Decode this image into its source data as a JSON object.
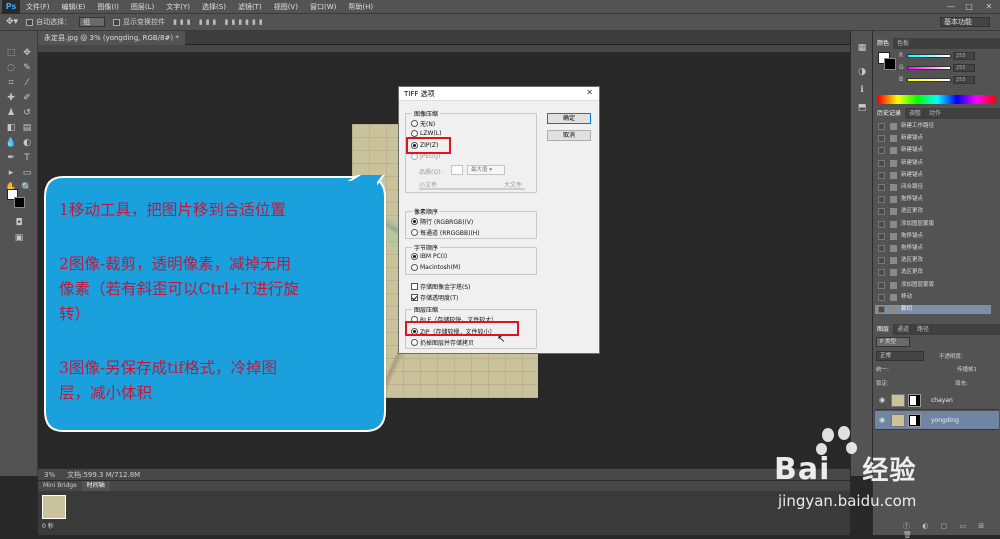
{
  "app": {
    "logo": "Ps"
  },
  "menu": [
    "文件(F)",
    "编辑(E)",
    "图像(I)",
    "图层(L)",
    "文字(Y)",
    "选择(S)",
    "滤镜(T)",
    "视图(V)",
    "窗口(W)",
    "帮助(H)"
  ],
  "options_bar": {
    "auto_select_label": "自动选择：",
    "auto_select_value": "组",
    "show_transform_label": "显示变换控件",
    "workspace": "基本功能"
  },
  "document": {
    "tab_title": "永定县.jpg @ 3% (yongding, RGB/8#) *",
    "zoom": "3%",
    "doc_size": "文档:599.3 M/712.8M"
  },
  "bridge": {
    "tabs": [
      "Mini Bridge",
      "时间轴"
    ],
    "frame_time": "0 秒"
  },
  "color_panel": {
    "tabs": [
      "颜色",
      "色板"
    ],
    "channels": [
      {
        "label": "R",
        "value": "255"
      },
      {
        "label": "G",
        "value": "255"
      },
      {
        "label": "B",
        "value": "255"
      }
    ]
  },
  "history_panel": {
    "tabs": [
      "历史记录",
      "调整",
      "动作"
    ],
    "items": [
      "新建工作路径",
      "新建锚点",
      "新建锚点",
      "新建锚点",
      "新建锚点",
      "闭合路径",
      "拖移锚点",
      "选区更改",
      "添加图层蒙版",
      "拖移锚点",
      "拖移锚点",
      "选区更改",
      "选区更改",
      "添加图层蒙版",
      "移动",
      "裁切"
    ],
    "selected_index": 15
  },
  "layers_panel": {
    "tabs": [
      "图层",
      "通道",
      "路径"
    ],
    "filter_label": "P 类型",
    "blend_mode": "正常",
    "opacity_label": "不透明度:",
    "lock_label": "锁定:",
    "fill_label": "填充:",
    "propagate_label": "传播帧1",
    "unify_label": "统一:",
    "layers": [
      {
        "name": "chayan",
        "selected": false
      },
      {
        "name": "yongding",
        "selected": true
      }
    ]
  },
  "dialog": {
    "title": "TIFF 选项",
    "image_compression": {
      "label": "图像压缩",
      "options": [
        "无(N)",
        "LZW(L)",
        "ZIP(Z)",
        "JPEG(J)"
      ],
      "selected": "ZIP(Z)",
      "quality_label": "品质(Q):",
      "quality_value": "最大值",
      "small_file": "小文件",
      "large_file": "大文件"
    },
    "pixel_order": {
      "label": "像素顺序",
      "options": [
        "隔行 (RGBRGB)(V)",
        "每通道 (RRGGBB)(H)"
      ],
      "selected": "隔行 (RGBRGB)(V)"
    },
    "byte_order": {
      "label": "字节顺序",
      "options": [
        "IBM PC(I)",
        "Macintosh(M)"
      ],
      "selected": "IBM PC(I)"
    },
    "save_pyramid": "存储图像金字塔(S)",
    "save_transparency": "存储透明度(T)",
    "layer_compression": {
      "label": "图层压缩",
      "options": [
        "RLE（存储较快，文件较大）",
        "ZIP（存储较慢，文件较小）",
        "扔掉图层并存储拷贝"
      ],
      "selected": "ZIP（存储较慢，文件较小）"
    },
    "ok_button": "确定",
    "cancel_button": "取消"
  },
  "callout": {
    "lines": [
      "1移动工具，把图片移到合适位置",
      "2图像-裁剪，透明像素，减掉无用",
      "像素（若有斜歪可以Ctrl+T进行旋",
      "转）",
      "3图像-另保存成tif格式，冷掉图",
      "层，减小体积"
    ]
  },
  "watermark": {
    "brand": "Bai",
    "brand_suffix": "经验",
    "url": "jingyan.baidu.com"
  },
  "colors": {
    "callout_fill": "#1aa0dc",
    "callout_text": "#c0193f",
    "highlight_red": "#e2121f",
    "ps_blue": "#31a8ff"
  }
}
